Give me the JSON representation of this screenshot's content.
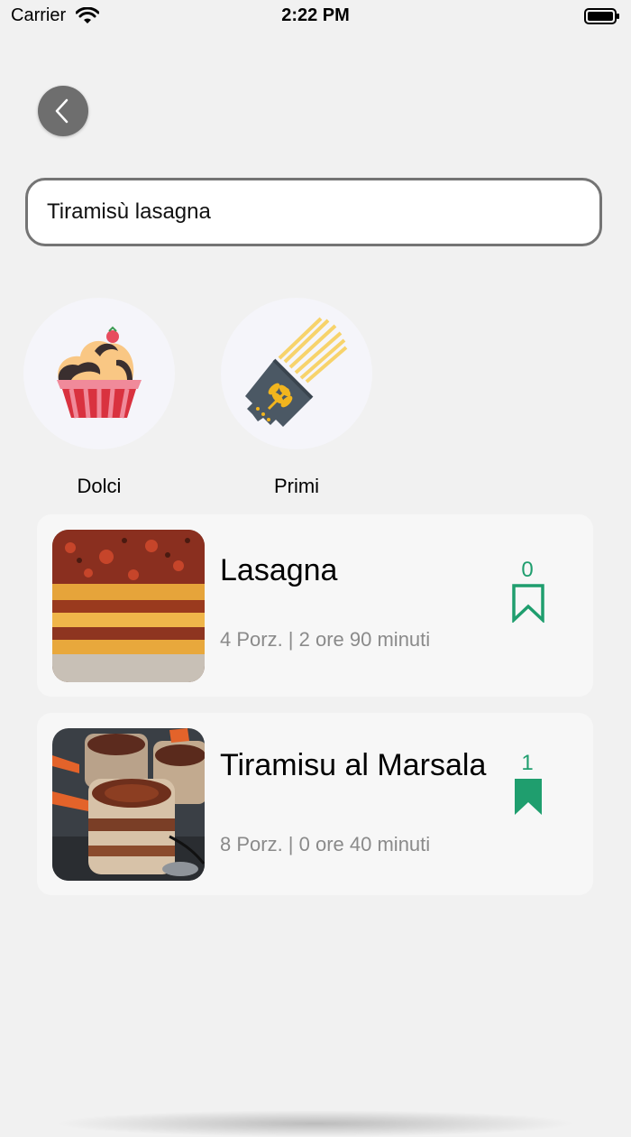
{
  "status_bar": {
    "carrier": "Carrier",
    "time": "2:22 PM"
  },
  "search": {
    "value": "Tiramisù lasagna"
  },
  "categories": [
    {
      "label": "Dolci",
      "icon": "cupcake-icon"
    },
    {
      "label": "Primi",
      "icon": "pasta-package-icon"
    }
  ],
  "recipes": [
    {
      "title": "Lasagna",
      "meta": "4 Porz. | 2 ore 90 minuti",
      "bookmarks": "0",
      "bookmarked": false
    },
    {
      "title": "Tiramisu al Marsala",
      "meta": "8 Porz. | 0 ore 40 minuti",
      "bookmarks": "1",
      "bookmarked": true
    }
  ],
  "colors": {
    "accent": "#1f9e6e",
    "background": "#f1f1f1"
  }
}
